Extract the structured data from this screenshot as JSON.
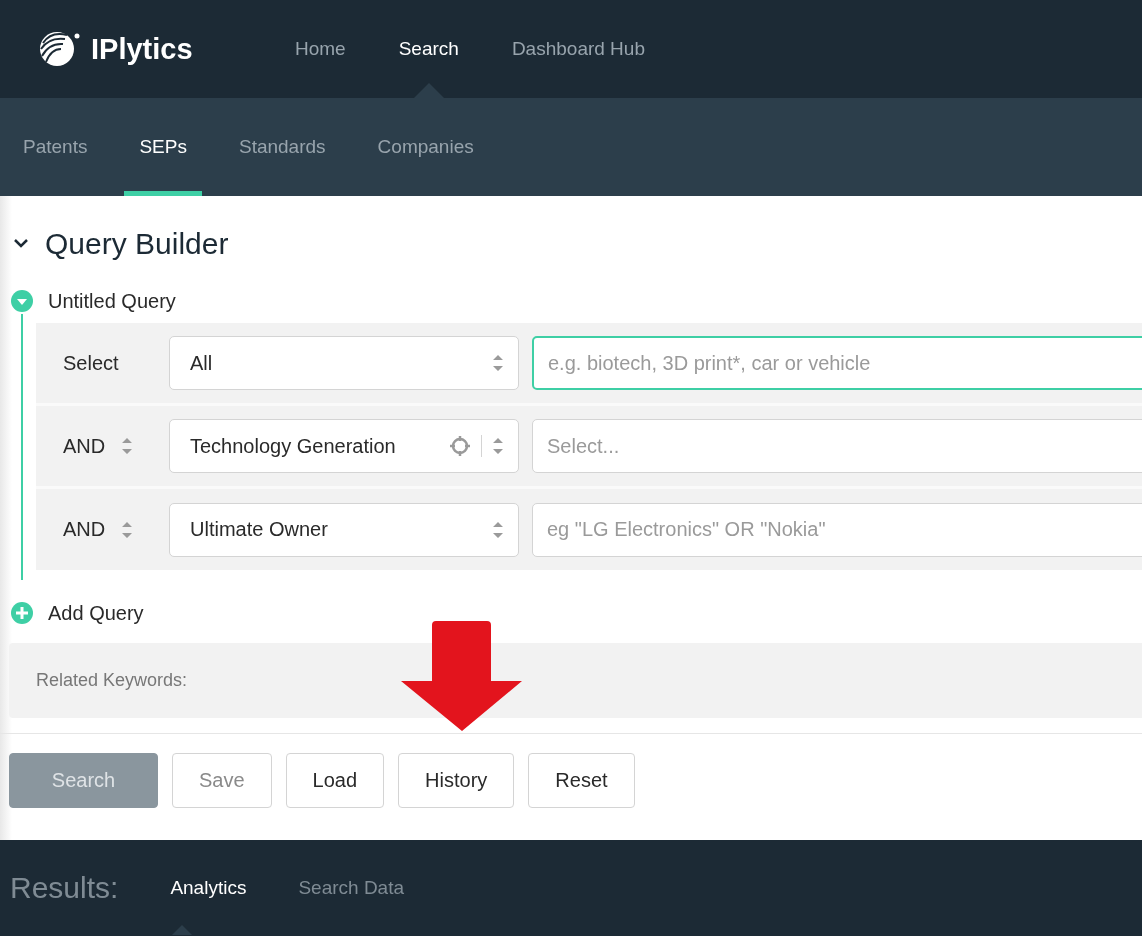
{
  "brand": {
    "name": "IPlytics"
  },
  "main_nav": [
    {
      "label": "Home",
      "selected": false
    },
    {
      "label": "Search",
      "selected": true
    },
    {
      "label": "Dashboard Hub",
      "selected": false
    }
  ],
  "sub_nav": [
    {
      "label": "Patents",
      "selected": false
    },
    {
      "label": "SEPs",
      "selected": true
    },
    {
      "label": "Standards",
      "selected": false
    },
    {
      "label": "Companies",
      "selected": false
    }
  ],
  "query_builder": {
    "title": "Query Builder",
    "expanded": true,
    "query": {
      "name": "Untitled Query",
      "expanded": true,
      "rows": [
        {
          "kind": "select",
          "operator": "Select",
          "field": "All",
          "has_target": false,
          "placeholder": "e.g. biotech, 3D print*, car or vehicle",
          "focused": true
        },
        {
          "kind": "and",
          "operator": "AND",
          "field": "Technology Generation",
          "has_target": true,
          "placeholder": "Select...",
          "focused": false
        },
        {
          "kind": "and",
          "operator": "AND",
          "field": "Ultimate Owner",
          "has_target": false,
          "placeholder": "eg \"LG Electronics\" OR \"Nokia\"",
          "focused": false
        }
      ]
    },
    "add_query": "Add Query",
    "related_keywords": "Related Keywords:"
  },
  "buttons": [
    {
      "kind": "primary",
      "label": "Search",
      "disabled": true
    },
    {
      "kind": "default",
      "label": "Save",
      "disabled": true
    },
    {
      "kind": "default",
      "label": "Load",
      "disabled": false
    },
    {
      "kind": "default",
      "label": "History",
      "disabled": false
    },
    {
      "kind": "default",
      "label": "Reset",
      "disabled": false
    }
  ],
  "results": {
    "label": "Results:",
    "tabs": [
      {
        "label": "Analytics",
        "selected": true
      },
      {
        "label": "Search Data",
        "selected": false
      }
    ]
  },
  "annotation": {
    "kind": "down_arrow"
  }
}
